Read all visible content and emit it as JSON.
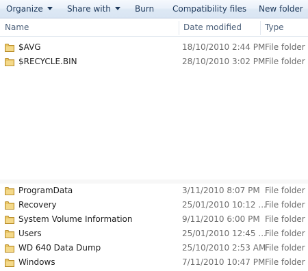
{
  "toolbar": {
    "organize": "Organize",
    "share_with": "Share with",
    "burn": "Burn",
    "compatibility_files": "Compatibility files",
    "new_folder": "New folder"
  },
  "columns": {
    "name": "Name",
    "date_modified": "Date modified",
    "type": "Type"
  },
  "rows": [
    {
      "name": "$AVG",
      "date": "18/10/2010 2:44 PM",
      "type": "File folder",
      "icon": "folder-icon"
    },
    {
      "name": "$RECYCLE.BIN",
      "date": "28/10/2010 3:02 PM",
      "type": "File folder",
      "icon": "folder-icon"
    },
    {
      "name": "ProgramData",
      "date": "3/11/2010 8:07 PM",
      "type": "File folder",
      "icon": "folder-icon"
    },
    {
      "name": "Recovery",
      "date": "25/01/2010 10:12 ...",
      "type": "File folder",
      "icon": "folder-icon"
    },
    {
      "name": "System Volume Information",
      "date": "9/11/2010 6:00 PM",
      "type": "File folder",
      "icon": "folder-icon"
    },
    {
      "name": "Users",
      "date": "25/01/2010 12:45 ...",
      "type": "File folder",
      "icon": "folder-icon"
    },
    {
      "name": "WD 640 Data Dump",
      "date": "25/10/2010 2:53 AM",
      "type": "File folder",
      "icon": "folder-icon"
    },
    {
      "name": "Windows",
      "date": "7/11/2010 10:47 PM",
      "type": "File folder",
      "icon": "folder-icon"
    }
  ]
}
